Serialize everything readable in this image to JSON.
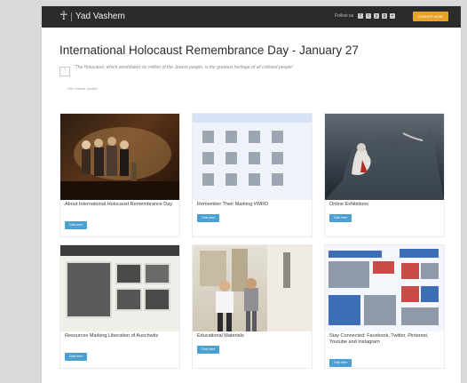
{
  "header": {
    "logo_mark": "☥",
    "logo_text": "Yad Vashem",
    "follow_label": "Follow us",
    "social_icons": [
      "f",
      "t",
      "y",
      "g",
      "+"
    ],
    "cta_label": "DONATE NOW"
  },
  "main": {
    "title": "International Holocaust Remembrance Day - January 27",
    "quote": {
      "mark": "“",
      "text": "“The Holocaust, which annihilated six million of the Jewish people, is the greatest heritage of all civilized people”",
      "attribution": "- Elie Wiesel quoted"
    },
    "cards": [
      {
        "caption": "About International Holocaust Remembrance Day",
        "button": "Click here",
        "image": "ceremony-photo"
      },
      {
        "caption": "Remember Their Marking #WRD",
        "button": "Click here",
        "image": "names-wall-photo"
      },
      {
        "caption": "Online Exhibitions",
        "button": "Click here",
        "image": "exhibition-photo"
      },
      {
        "caption": "Resources Marking Liberation of Auschwitz",
        "button": "Click here",
        "image": "archive-document-photo"
      },
      {
        "caption": "Educational Materials",
        "button": "Click here",
        "image": "education-photo"
      },
      {
        "caption": "Stay Connected: Facebook, Twitter, Pinterest, Youtube and Instagram",
        "button": "Click here",
        "image": "social-news-collage"
      }
    ]
  },
  "colors": {
    "topbar": "#2b2b2b",
    "accent_button": "#4a9fd3",
    "cta": "#e8a22a"
  }
}
